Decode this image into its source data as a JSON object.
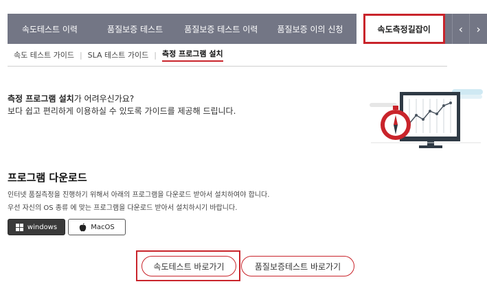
{
  "tabs": [
    {
      "label": "속도테스트 이력"
    },
    {
      "label": "품질보증 테스트"
    },
    {
      "label": "품질보증 테스트 이력"
    },
    {
      "label": "품질보증 이의 신청"
    },
    {
      "label": "속도측정길잡이"
    }
  ],
  "nav_arrows": {
    "prev": "‹",
    "next": "›"
  },
  "subnav": [
    {
      "label": "속도 테스트 가이드"
    },
    {
      "label": "SLA 테스트 가이드"
    },
    {
      "label": "측정 프로그램 설치"
    }
  ],
  "intro": {
    "bold": "측정 프로그램 설치",
    "rest": "가 어려우신가요?",
    "line2": "보다 쉽고 편리하게 이용하실 수 있도록 가이드를 제공해 드립니다."
  },
  "download": {
    "heading": "프로그램 다운로드",
    "desc1": "인터넷 품질측정을 진행하기 위해서 아래의 프로그램을 다운로드 받아서 설치하여야 합니다.",
    "desc2": "우선 자신의 OS 종류 에 맞는 프로그램을 다운로드 받아서 설치하시기 바랍니다.",
    "windows_label": "windows",
    "mac_label": "MacOS"
  },
  "actions": {
    "speed_test": "속도테스트 바로가기",
    "quality_test": "품질보증테스트 바로가기"
  },
  "colors": {
    "tab_bg": "#737685",
    "accent": "#c9242b"
  }
}
